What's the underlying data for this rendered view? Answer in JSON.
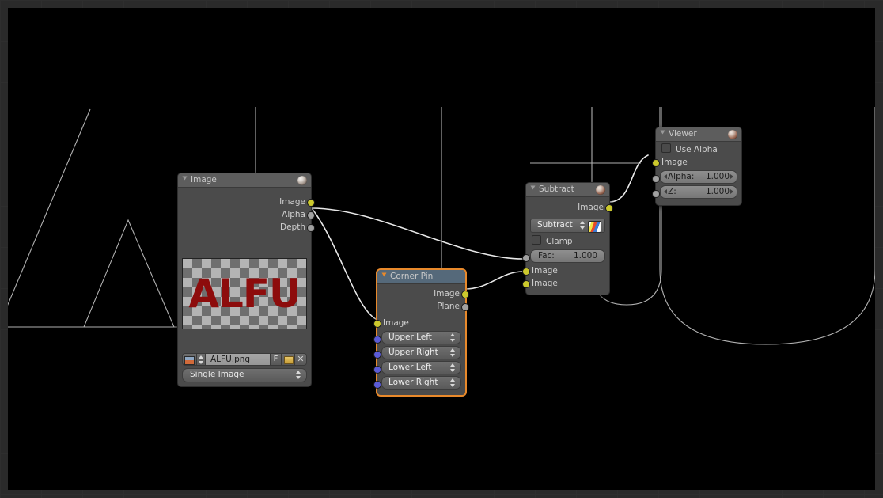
{
  "app": {
    "editor": "node-editor",
    "background_color": "#000000",
    "frame_color": "#2a2a2a"
  },
  "background_render": {
    "description": "Large outlined ALFU letters rendered behind the nodes",
    "text": "ALFU",
    "stroke_color": "#b4b4b4"
  },
  "nodes": [
    {
      "id": "image",
      "title": "Image",
      "selected": false,
      "has_preview_ball": true,
      "outputs": [
        {
          "label": "Image",
          "type": "image"
        },
        {
          "label": "Alpha",
          "type": "value"
        },
        {
          "label": "Depth",
          "type": "value"
        }
      ],
      "preview": {
        "text": "ALFU",
        "text_color": "#8d0c0c"
      },
      "file": {
        "name": "ALFU.png",
        "fake_user_label": "F",
        "browse_icon": "image-datablock-icon",
        "folder_icon": "open-file-icon",
        "unlink_icon": "unlink-icon"
      },
      "source": "Single Image"
    },
    {
      "id": "corner_pin",
      "title": "Corner Pin",
      "selected": true,
      "header_style": "distort",
      "outputs": [
        {
          "label": "Image",
          "type": "image"
        },
        {
          "label": "Plane",
          "type": "value"
        }
      ],
      "inputs": [
        {
          "label": "Image",
          "type": "image",
          "widget": false
        },
        {
          "label": "Upper Left",
          "type": "vector",
          "widget": true
        },
        {
          "label": "Upper Right",
          "type": "vector",
          "widget": true
        },
        {
          "label": "Lower Left",
          "type": "vector",
          "widget": true
        },
        {
          "label": "Lower Right",
          "type": "vector",
          "widget": true
        }
      ]
    },
    {
      "id": "subtract",
      "title": "Subtract",
      "selected": false,
      "has_preview_ball": true,
      "outputs": [
        {
          "label": "Image",
          "type": "image"
        }
      ],
      "blend_mode": "Subtract",
      "ramp_icon": "color-ramp-icon",
      "clamp": {
        "label": "Clamp",
        "checked": false
      },
      "fac": {
        "label": "Fac:",
        "value": "1.000"
      },
      "inputs": [
        {
          "label": "Image",
          "type": "image"
        },
        {
          "label": "Image",
          "type": "image"
        }
      ]
    },
    {
      "id": "viewer",
      "title": "Viewer",
      "selected": false,
      "has_preview_ball": true,
      "use_alpha": {
        "label": "Use Alpha",
        "checked": false
      },
      "inputs": [
        {
          "label": "Image",
          "type": "image"
        },
        {
          "label": "Alpha:",
          "type": "value",
          "value": "1.000"
        },
        {
          "label": "Z:",
          "type": "value",
          "value": "1.000"
        }
      ]
    }
  ],
  "links": [
    {
      "from": "image.Alpha",
      "to": "subtract.Image-1"
    },
    {
      "from": "image.Alpha",
      "to": "corner_pin.Image"
    },
    {
      "from": "corner_pin.Image",
      "to": "subtract.Image-2"
    },
    {
      "from": "subtract.Image",
      "to": "viewer.Image"
    }
  ],
  "socket_colors": {
    "image": "#ccc92d",
    "value": "#a1a1a1",
    "vector": "#5b5bd6"
  }
}
